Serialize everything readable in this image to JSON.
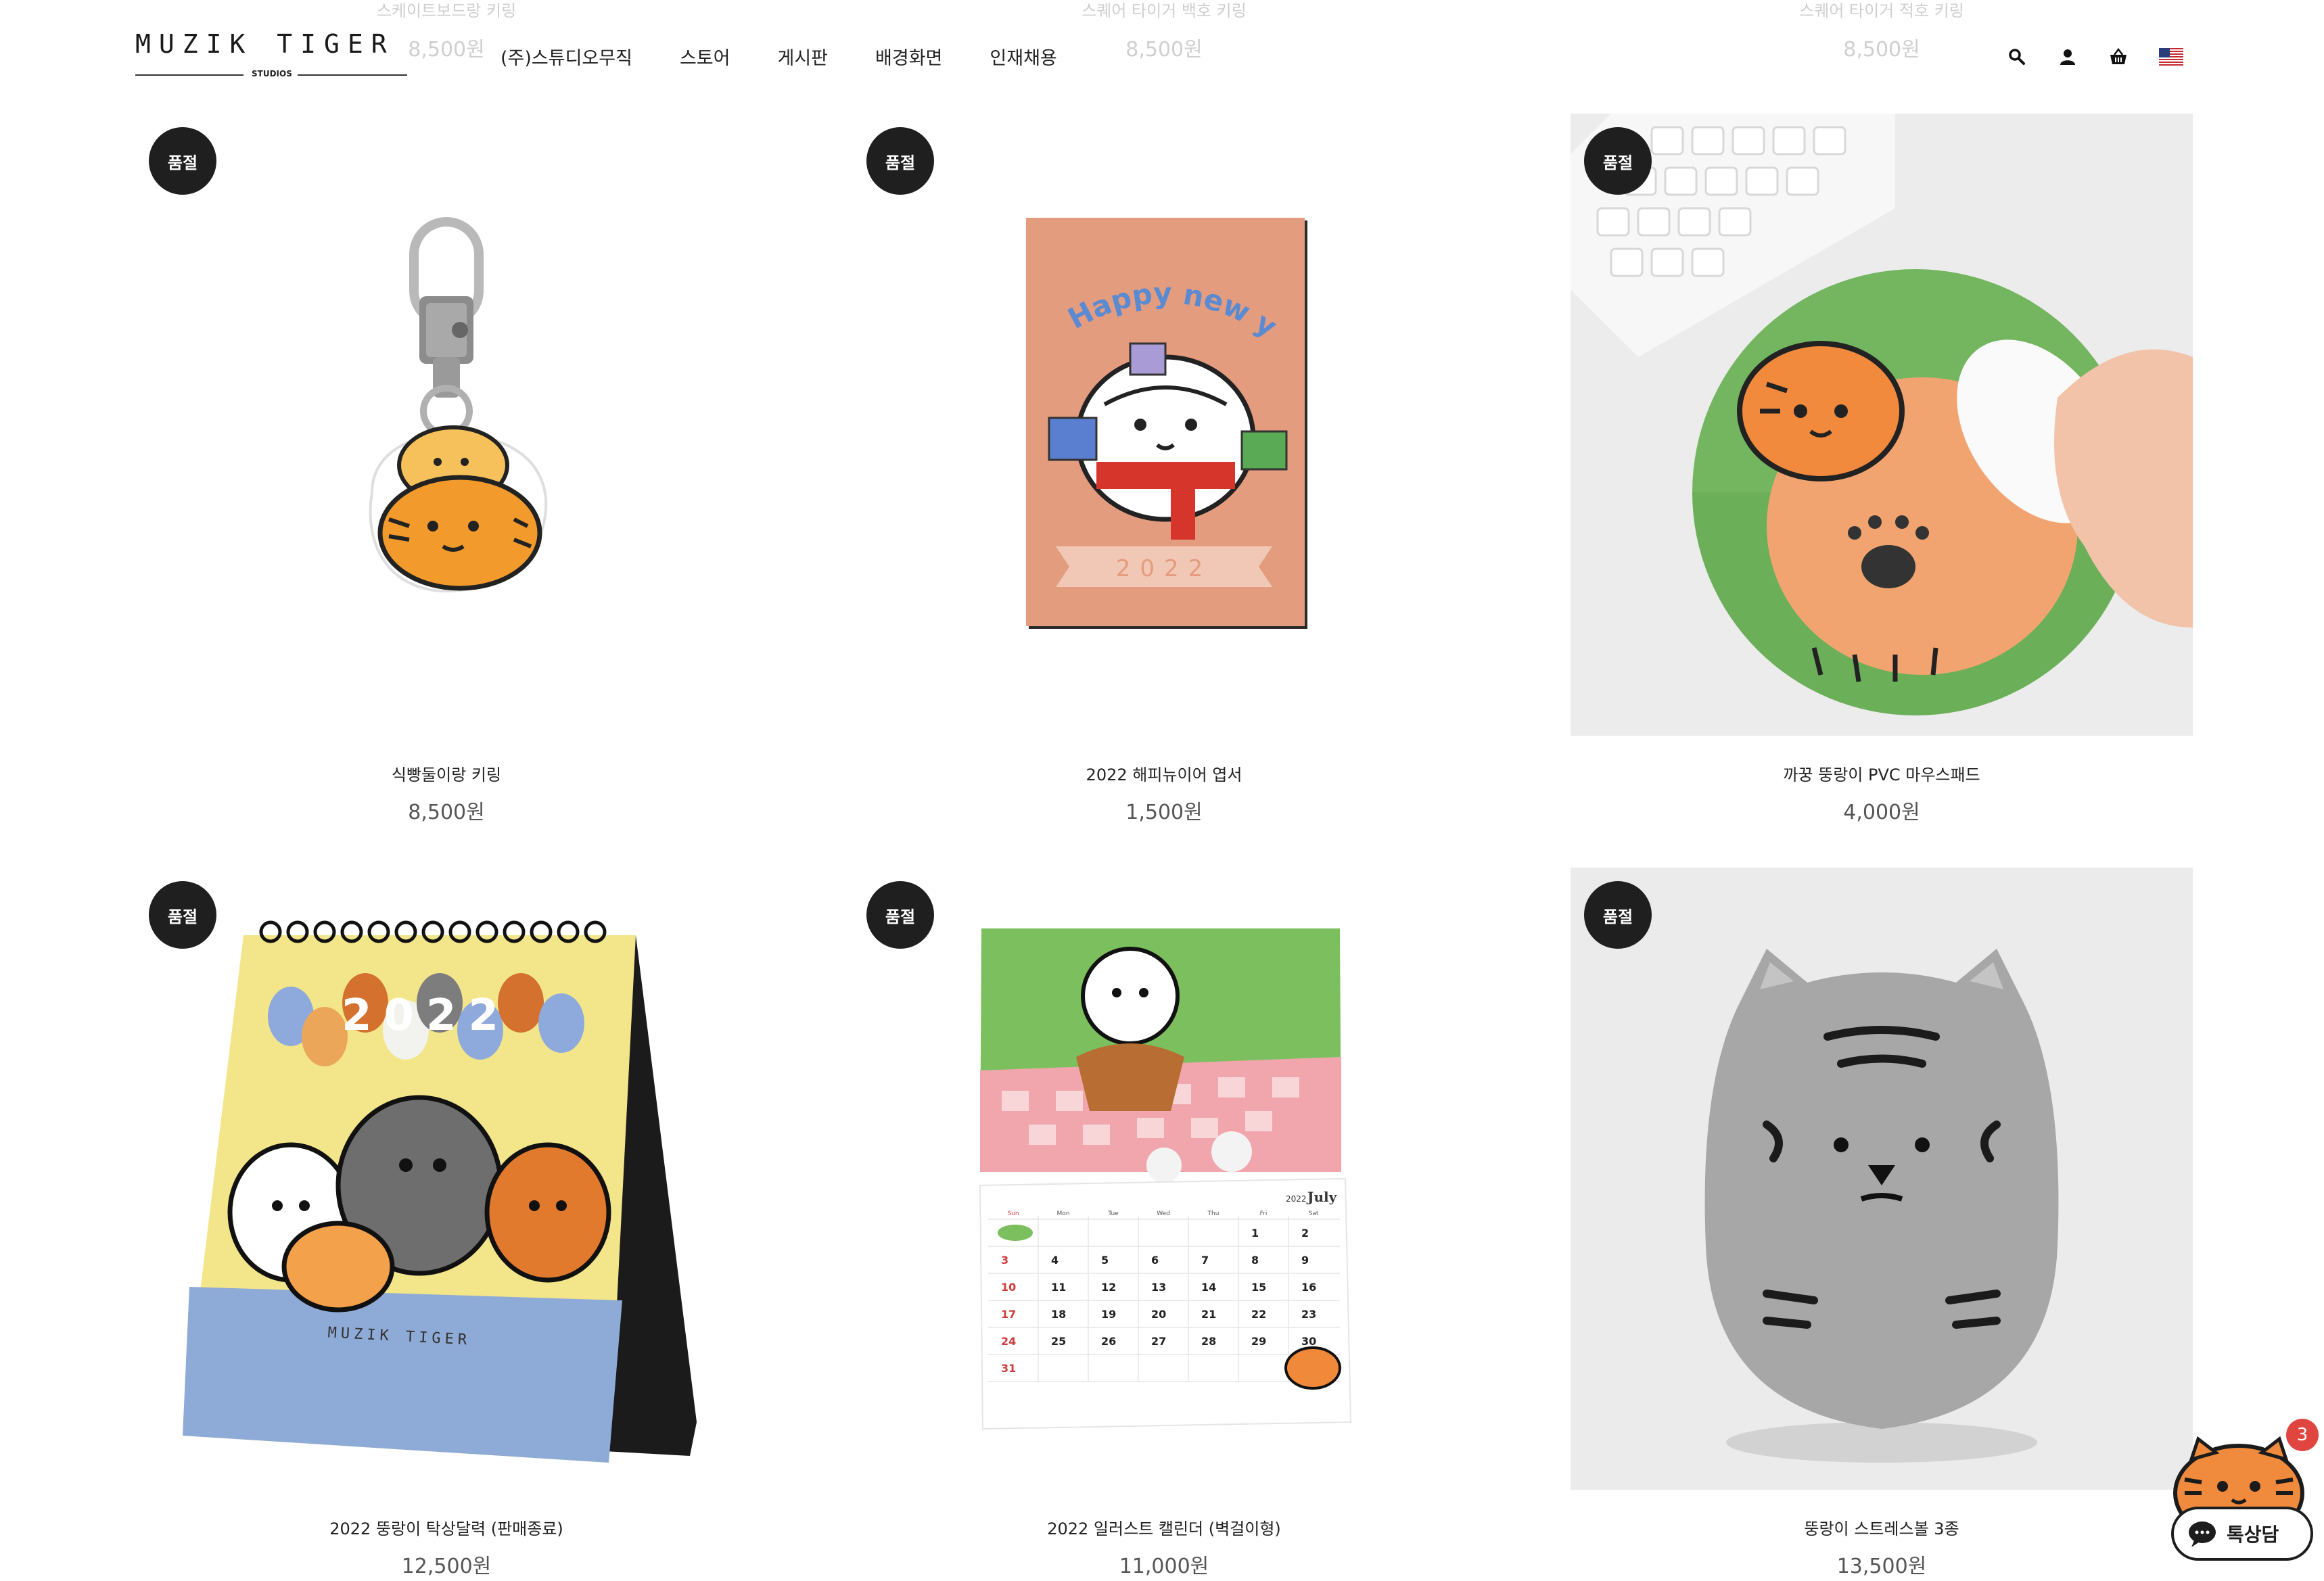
{
  "brand": {
    "logo_text": "MUZIK TIGER",
    "logo_sub": "STUDIOS"
  },
  "nav": [
    "(주)스튜디오무직",
    "스토어",
    "게시판",
    "배경화면",
    "인재채용"
  ],
  "tools": [
    "search-icon",
    "user-icon",
    "basket-icon",
    "us-flag-icon"
  ],
  "ghost_products": [
    {
      "name": "스케이트보드랑 키링",
      "price": "8,500원"
    },
    {
      "name": "스퀘어 타이거 백호 키링",
      "price": "8,500원"
    },
    {
      "name": "스퀘어 타이거 적호 키링",
      "price": "8,500원"
    }
  ],
  "products": [
    {
      "name": "식빵둘이랑 키링",
      "price": "8,500원",
      "badge": "품절",
      "image": "keyring"
    },
    {
      "name": "2022 해피뉴이어 엽서",
      "price": "1,500원",
      "badge": "품절",
      "image": "postcard"
    },
    {
      "name": "까꿍 뚱랑이 PVC 마우스패드",
      "price": "4,000원",
      "badge": "품절",
      "image": "mousepad"
    },
    {
      "name": "2022 뚱랑이 탁상달력 (판매종료)",
      "price": "12,500원",
      "badge": "품절",
      "image": "desk-calendar"
    },
    {
      "name": "2022 일러스트 캘린더 (벽걸이형)",
      "price": "11,000원",
      "badge": "품절",
      "image": "wall-calendar"
    },
    {
      "name": "뚱랑이 스트레스볼 3종",
      "price": "13,500원",
      "badge": "품절",
      "image": "stress-ball"
    }
  ],
  "postcard_text": "Happy new year!",
  "postcard_year": "2022",
  "desk_calendar": {
    "year": "2022",
    "brand": "MUZIK TIGER"
  },
  "wall_calendar": {
    "year": "2022",
    "month": "July",
    "weekdays": [
      "Sun",
      "Mon",
      "Tue",
      "Wed",
      "Thu",
      "Fri",
      "Sat"
    ],
    "weeks": [
      [
        "",
        "",
        "",
        "",
        "",
        "1",
        "2"
      ],
      [
        "3",
        "4",
        "5",
        "6",
        "7",
        "8",
        "9"
      ],
      [
        "10",
        "11",
        "12",
        "13",
        "14",
        "15",
        "16"
      ],
      [
        "17",
        "18",
        "19",
        "20",
        "21",
        "22",
        "23"
      ],
      [
        "24",
        "25",
        "26",
        "27",
        "28",
        "29",
        "30"
      ],
      [
        "31",
        "",
        "",
        "",
        "",
        "",
        ""
      ]
    ]
  },
  "chat": {
    "label": "톡상담",
    "count": "3"
  },
  "colors": {
    "badge": "#1f1f1f",
    "accent_red": "#e0463f",
    "tiger_orange": "#f08a3c"
  }
}
